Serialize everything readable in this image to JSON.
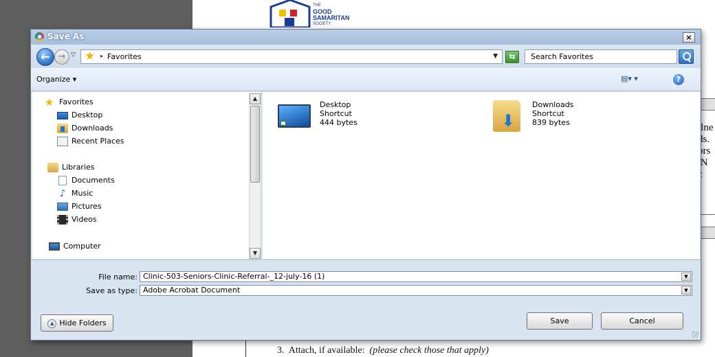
{
  "background": {
    "logo": {
      "line1": "THE",
      "line2": "GOOD",
      "line3": "SAMARITAN",
      "line4": "SOCIETY"
    },
    "doc_snippets": [
      "ılne",
      "ds.",
      "ors",
      "N",
      "c"
    ],
    "doc_bottom": {
      "number": "3.",
      "text": "Attach, if available:",
      "italic": "(please check those that apply)"
    }
  },
  "dialog": {
    "title": "Save As",
    "close_label": "×",
    "address": {
      "location": "Favorites"
    },
    "search": {
      "placeholder": "Search Favorites"
    },
    "toolbar": {
      "organize_label": "Organize ▾",
      "help_label": "?"
    },
    "sidebar": {
      "favorites": {
        "header": "Favorites",
        "items": [
          {
            "label": "Desktop",
            "icon": "desktop-icon"
          },
          {
            "label": "Downloads",
            "icon": "downloads-icon"
          },
          {
            "label": "Recent Places",
            "icon": "recent-places-icon"
          }
        ]
      },
      "libraries": {
        "header": "Libraries",
        "items": [
          {
            "label": "Documents",
            "icon": "documents-icon"
          },
          {
            "label": "Music",
            "icon": "music-icon"
          },
          {
            "label": "Pictures",
            "icon": "pictures-icon"
          },
          {
            "label": "Videos",
            "icon": "videos-icon"
          }
        ]
      },
      "computer": {
        "header": "Computer"
      }
    },
    "files": [
      {
        "name": "Desktop",
        "type": "Shortcut",
        "size": "444 bytes",
        "icon": "desktop-shortcut-icon"
      },
      {
        "name": "Downloads",
        "type": "Shortcut",
        "size": "839 bytes",
        "icon": "downloads-folder-icon"
      }
    ],
    "file_name": {
      "label": "File name:",
      "value": "Clinic-503-Seniors-Clinic-Referral-_12-july-16 (1)"
    },
    "save_as_type": {
      "label": "Save as type:",
      "value": "Adobe Acrobat Document"
    },
    "buttons": {
      "hide_folders": "Hide Folders",
      "save": "Save",
      "cancel": "Cancel"
    }
  }
}
